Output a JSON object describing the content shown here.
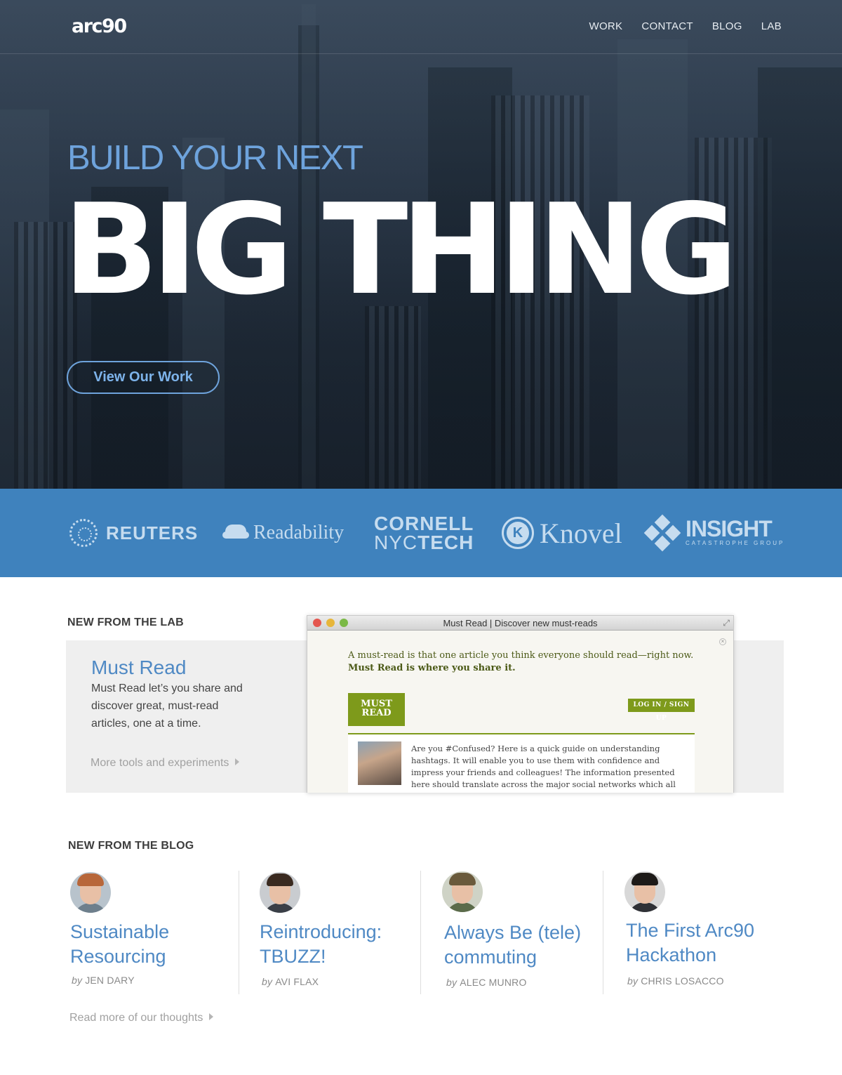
{
  "header": {
    "logo": "arc90",
    "nav": [
      "WORK",
      "CONTACT",
      "BLOG",
      "LAB"
    ]
  },
  "hero": {
    "tagline": "BUILD YOUR NEXT",
    "headline": "BIG THING",
    "cta": "View Our Work"
  },
  "clients": {
    "reuters": "REUTERS",
    "readability": "Readability",
    "cornell_line1": "CORNELL",
    "cornell_line2a": "NYC",
    "cornell_line2b": "TECH",
    "knovel_mark": "K",
    "knovel": "Knovel",
    "insight": "INSIGHT",
    "insight_sub": "CATASTROPHE GROUP"
  },
  "lab": {
    "section_title": "NEW FROM THE LAB",
    "name": "Must Read",
    "description": "Must Read  let’s you share and discover great, must-read articles, one at a time.",
    "more_link": "More tools and experiments",
    "screenshot": {
      "window_title": "Must Read | Discover new must-reads",
      "intro": "A must-read is that one article you think everyone should read—right now.",
      "intro_bold": "Must Read is where you share it.",
      "logo_line1": "MUST",
      "logo_line2": "READ",
      "login": "LOG IN / SIGN UP",
      "card_text": "Are you #Confused? Here is a quick guide on understanding hashtags. It will enable you to use them with confidence and impress your friends and colleagues! The information presented here should translate across the major social networks which all"
    }
  },
  "blog": {
    "section_title": "NEW FROM THE BLOG",
    "by": "by",
    "posts": [
      {
        "title_line1": "Sustainable",
        "title_line2": "Resourcing",
        "author": "JEN DARY"
      },
      {
        "title_line1": "Reintroducing:",
        "title_line2": "TBUZZ!",
        "author": "AVI FLAX"
      },
      {
        "title_line1": "Always Be (tele)",
        "title_line2": "commuting",
        "author": "ALEC MUNRO"
      },
      {
        "title_line1": "The First Arc90",
        "title_line2": "Hackathon",
        "author": "CHRIS LOSACCO"
      }
    ],
    "more_link": "Read more of our thoughts"
  },
  "colors": {
    "accent_blue": "#4f89c4",
    "hero_tagline": "#6ea3dc",
    "client_band": "#3f82bd",
    "mustread_green": "#7e9a1b"
  }
}
